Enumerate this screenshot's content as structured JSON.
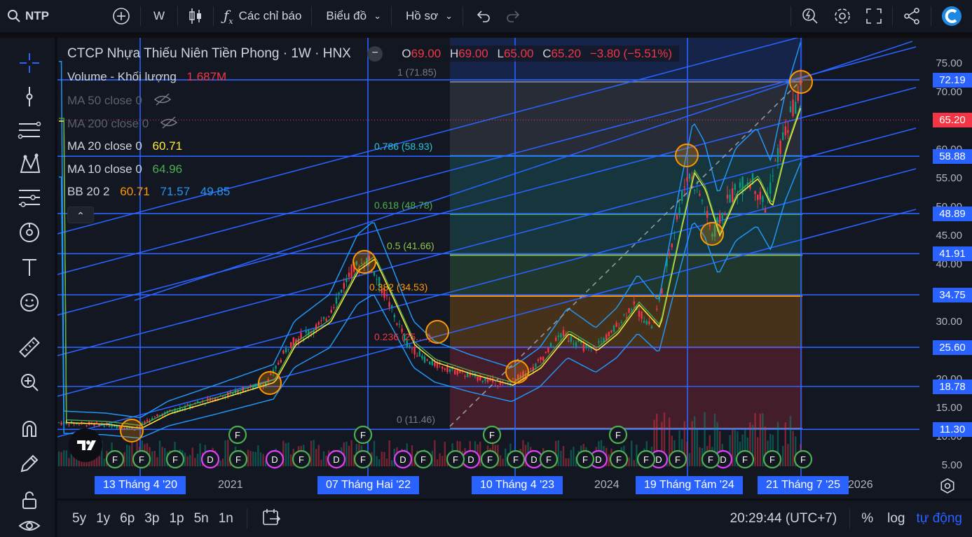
{
  "topbar": {
    "symbol": "NTP",
    "interval": "W",
    "indicators_label": "Các chỉ báo",
    "chart_label": "Biểu đồ",
    "profile_label": "Hồ sơ"
  },
  "legend": {
    "title": "CTCP Nhựa Thiếu Niên Tiền Phong · 1W · HNX",
    "ohlc": {
      "o_label": "O",
      "o": "69.00",
      "h_label": "H",
      "h": "69.00",
      "l_label": "L",
      "l": "65.00",
      "c_label": "C",
      "c": "65.20",
      "change": "−3.80 (−5.51%)"
    },
    "volume": {
      "label": "Volume - Khối lượng",
      "value": "1.687M"
    },
    "ma50": {
      "label": "MA 50 close 0"
    },
    "ma200": {
      "label": "MA 200 close 0"
    },
    "ma20": {
      "label": "MA 20 close 0",
      "value": "60.71"
    },
    "ma10": {
      "label": "MA 10 close 0",
      "value": "64.96"
    },
    "bb": {
      "label": "BB 20 2",
      "v1": "60.71",
      "v2": "71.57",
      "v3": "49.85"
    }
  },
  "fib": [
    {
      "label": "1 (71.85)",
      "color": "#787b86"
    },
    {
      "label": "0.786 (58.93)",
      "color": "#26c6da"
    },
    {
      "label": "0.618 (48.78)",
      "color": "#4caf50"
    },
    {
      "label": "0.5 (41.66)",
      "color": "#8bc34a"
    },
    {
      "label": "0.382 (34.53)",
      "color": "#ff9800"
    },
    {
      "label": "0.236 (25.…)",
      "color": "#f23645"
    },
    {
      "label": "0 (11.46)",
      "color": "#787b86"
    }
  ],
  "price_axis": {
    "labels": [
      "75.00",
      "70.00",
      "60.00",
      "55.00",
      "50.00",
      "45.00",
      "40.00",
      "30.00",
      "25.00",
      "20.00",
      "15.00",
      "10.00",
      "5.00"
    ],
    "tags": [
      "72.19",
      "58.88",
      "48.89",
      "41.91",
      "34.75",
      "25.60",
      "18.78",
      "11.30"
    ],
    "last": "65.20",
    "last_color": "#f23645"
  },
  "time_axis": {
    "years": [
      "2021",
      "2024",
      "2026"
    ],
    "tags": [
      "13 Tháng 4 '20",
      "07 Tháng Hai '22",
      "10 Tháng 4 '23",
      "19 Tháng Tám '24",
      "21 Tháng 7 '25"
    ]
  },
  "events": {
    "f": "F",
    "d": "D"
  },
  "bottombar": {
    "ranges": [
      "5y",
      "1y",
      "6p",
      "3p",
      "1p",
      "5n",
      "1n"
    ],
    "clock": "20:29:44 (UTC+7)",
    "percent": "%",
    "log": "log",
    "auto": "tự động"
  },
  "colors": {
    "accent": "#2962ff",
    "up": "#089981",
    "down": "#f23645",
    "ma20": "#ffeb3b",
    "ma10": "#4caf50",
    "bb": "#2196f3"
  }
}
